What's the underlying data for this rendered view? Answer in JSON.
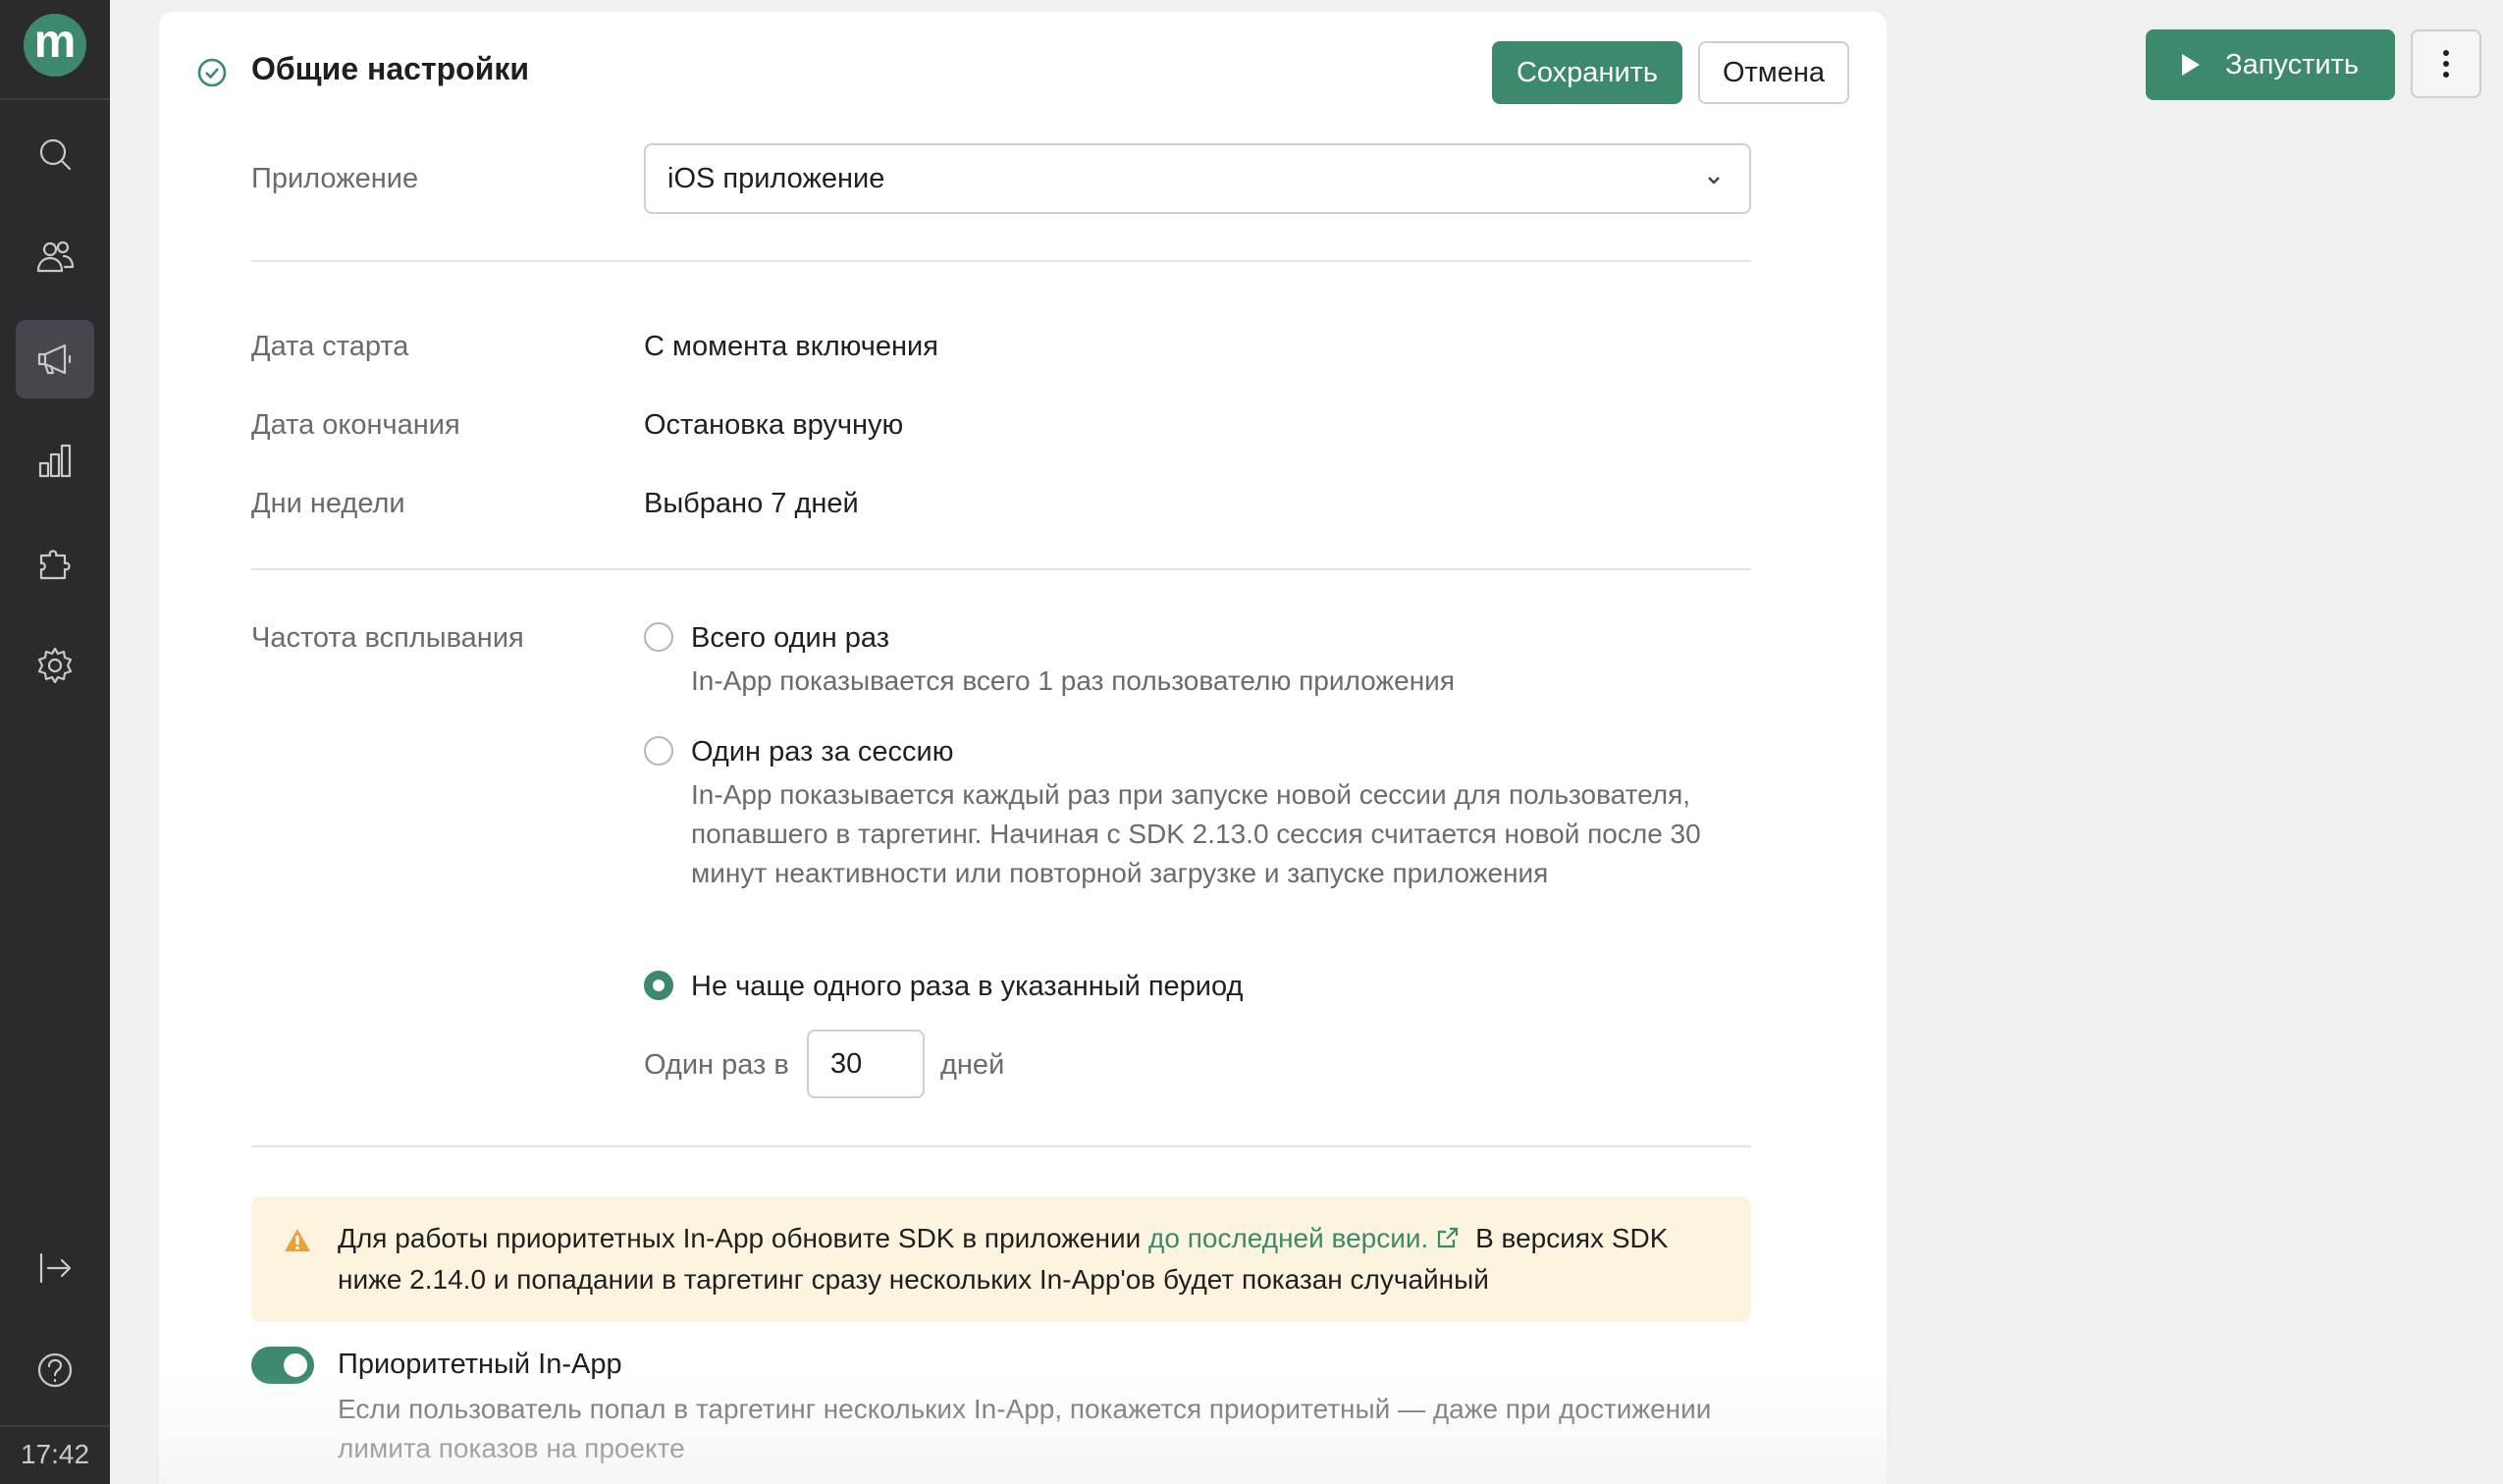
{
  "sidebar": {
    "logo_letter": "m",
    "nav": [
      {
        "name": "search-icon"
      },
      {
        "name": "users-icon"
      },
      {
        "name": "megaphone-icon",
        "active": true
      },
      {
        "name": "bar-chart-icon"
      },
      {
        "name": "puzzle-icon"
      },
      {
        "name": "gear-icon"
      }
    ],
    "bottom": [
      {
        "name": "logout-icon"
      },
      {
        "name": "help-icon"
      }
    ],
    "clock": "17:42"
  },
  "header": {
    "title": "Общие настройки",
    "save_label": "Сохранить",
    "cancel_label": "Отмена"
  },
  "topbar": {
    "run_label": "Запустить"
  },
  "form": {
    "app_label": "Приложение",
    "app_value": "iOS приложение",
    "start_label": "Дата старта",
    "start_value": "С момента включения",
    "end_label": "Дата окончания",
    "end_value": "Остановка вручную",
    "days_label": "Дни недели",
    "days_value": "Выбрано 7 дней",
    "freq_label": "Частота всплывания",
    "freq_options": [
      {
        "label": "Всего один раз",
        "desc": "In-App показывается всего 1 раз пользователю приложения",
        "selected": false
      },
      {
        "label": "Один раз за сессию",
        "desc": "In-App показывается каждый раз при запуске новой сессии для пользователя, попавшего в таргетинг. Начиная с SDK 2.13.0 сессия считается новой после 30 минут неактивности или повторной загрузке и запуске приложения",
        "selected": false
      },
      {
        "label": "Не чаще одного раза в указанный период",
        "desc": "",
        "selected": true
      }
    ],
    "period_prefix": "Один раз в",
    "period_value": "30",
    "period_suffix": "дней"
  },
  "alert": {
    "text_before": "Для работы приоритетных In-App обновите SDK в приложении ",
    "link_text": "до последней версии.",
    "text_after": " В версиях SDK ниже 2.14.0 и попадании в таргетинг сразу нескольких In-App'ов будет показан случайный"
  },
  "priority": {
    "label": "Приоритетный In-App",
    "desc": "Если пользователь попал в таргетинг нескольких In-App, покажется приоритетный — даже при достижении лимита показов на проекте",
    "enabled": true
  },
  "colors": {
    "accent": "#3c8a6b",
    "sidebar_bg": "#2b2b2e",
    "alert_bg": "#fdf4df",
    "warning": "#e8a23a"
  }
}
